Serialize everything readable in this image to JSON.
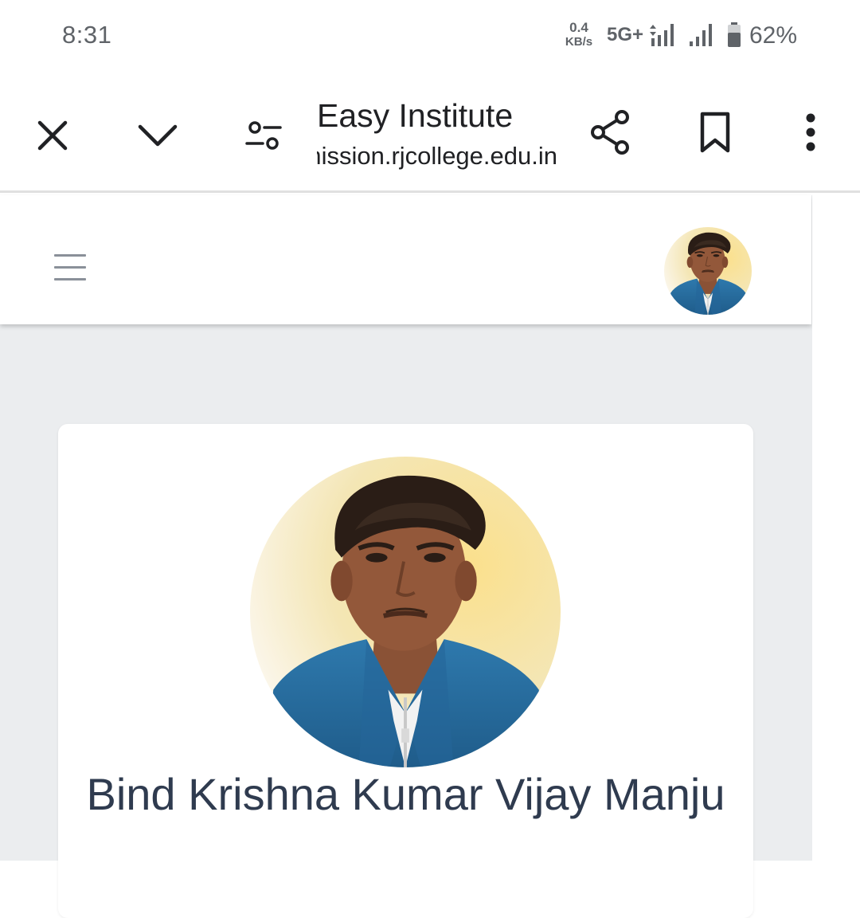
{
  "status_bar": {
    "time": "8:31",
    "net_speed_value": "0.4",
    "net_speed_unit": "KB/s",
    "network_type": "5G+",
    "battery": "62%"
  },
  "toolbar": {
    "title": "Easy Institute",
    "url": "admission.rjcollege.edu.in",
    "icons": [
      "close-icon",
      "chevron-down-icon",
      "page-info-icon",
      "share-icon",
      "bookmark-icon",
      "more-vert-icon"
    ]
  },
  "site": {
    "header_menu_icon": "hamburger-icon",
    "profile_name": "Bind Krishna Kumar Vijay Manju"
  },
  "colors": {
    "page_background": "#ebedef",
    "name_text": "#2f3b4f",
    "jacket_blue": "#2b6fa3",
    "photo_background": "#f6e3a1"
  }
}
